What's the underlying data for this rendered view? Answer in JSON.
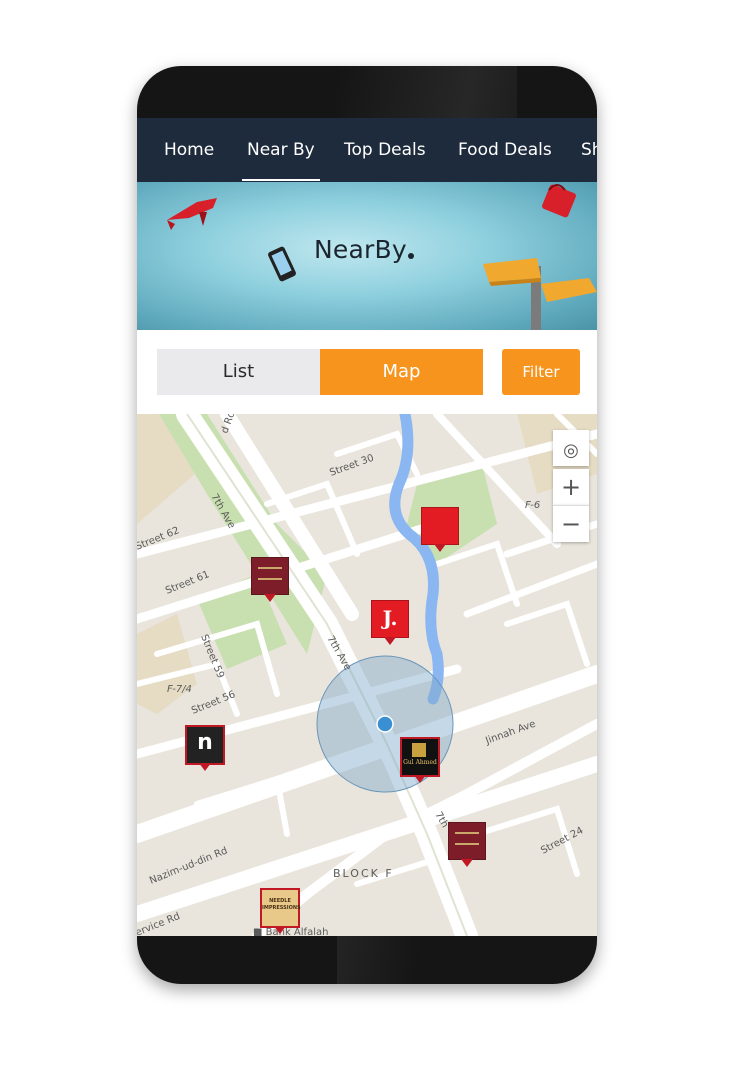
{
  "nav": {
    "tabs": [
      {
        "label": "Home"
      },
      {
        "label": "Near By",
        "active": true
      },
      {
        "label": "Top Deals"
      },
      {
        "label": "Food Deals"
      },
      {
        "label": "Sh"
      }
    ]
  },
  "banner": {
    "title": "NearBy"
  },
  "view_toggle": {
    "list_label": "List",
    "map_label": "Map",
    "selected": "Map"
  },
  "filter": {
    "label": "Filter"
  },
  "map": {
    "streets": [
      "Street 30",
      "Street 62",
      "Street 61",
      "Street 59",
      "Street 56",
      "Street 24",
      "7th Ave",
      "7th Ave",
      "Jinnah Ave",
      "Nazim-ud-din Rd",
      "d Rd",
      "ervice Rd",
      "F-7/4",
      "F-6",
      "BLOCK F",
      "Bank Alfalah",
      "7th"
    ],
    "zoom_controls": {
      "locate": "◎",
      "zoom_in": "+",
      "zoom_out": "−"
    },
    "markers": [
      {
        "name": "red-pin",
        "text": ""
      },
      {
        "name": "maroon-logo-1",
        "text": ""
      },
      {
        "name": "j-logo",
        "text": "J."
      },
      {
        "name": "n-logo",
        "text": "n"
      },
      {
        "name": "gul-ahmed-logo",
        "text": "Gul Ahmed"
      },
      {
        "name": "maroon-logo-2",
        "text": ""
      },
      {
        "name": "needle-impressions",
        "text": "NEEDLE IMPRESSIONS"
      }
    ]
  },
  "colors": {
    "nav_bg": "#1e2b3c",
    "accent": "#f7941d",
    "map_bg": "#e9e5dc",
    "road": "#ffffff",
    "park": "#c8dfb0",
    "water": "#8ab6f2"
  }
}
